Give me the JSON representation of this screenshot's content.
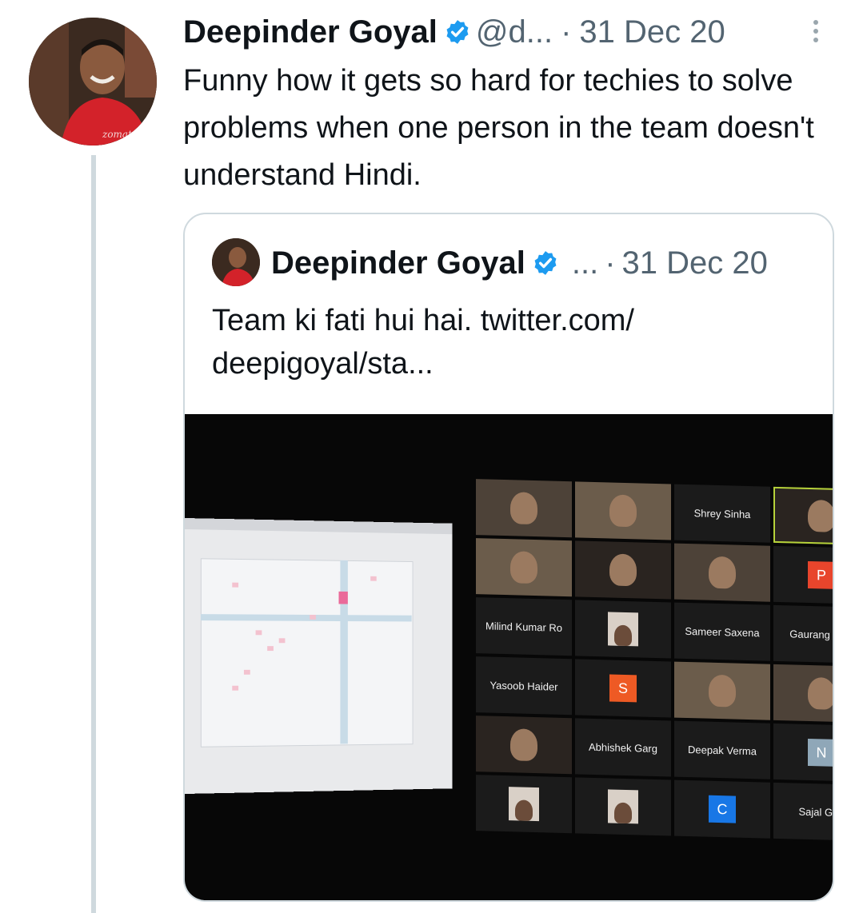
{
  "tweet": {
    "author_name": "Deepinder Goyal",
    "handle": "@d...",
    "separator": "·",
    "date": "31 Dec 20",
    "text": "Funny how it gets so hard for techies to solve problems when one person in the team doesn't understand Hindi."
  },
  "quote": {
    "author_name": "Deepinder Goyal",
    "handle": "...",
    "separator": "·",
    "date": "31 Dec 20",
    "text_line1": "Team ki fati hui hai. twitter.com/",
    "text_line2": "deepigoyal/sta..."
  },
  "video_call": {
    "participants": {
      "shrey": "Shrey Sinha",
      "milind": "Milind Kumar Ro",
      "sameer": "Sameer Saxena",
      "gaurang": "Gaurang Saw",
      "yasoob": "Yasoob Haider",
      "abhishek": "Abhishek Garg",
      "deepak": "Deepak Verma",
      "sajal": "Sajal Gup"
    },
    "initials": {
      "p": "P",
      "s": "S",
      "n": "N",
      "c": "C"
    },
    "initial_colors": {
      "p": "#e8452c",
      "s": "#ee5a24",
      "n": "#8fa7b8",
      "c": "#1877e6"
    }
  },
  "colors": {
    "verified_badge": "#1d9bf0",
    "secondary_text": "#536471",
    "thread_line": "#cfd9de"
  },
  "icons": {
    "verified": "verified-badge-icon",
    "more": "more-vertical-icon"
  }
}
